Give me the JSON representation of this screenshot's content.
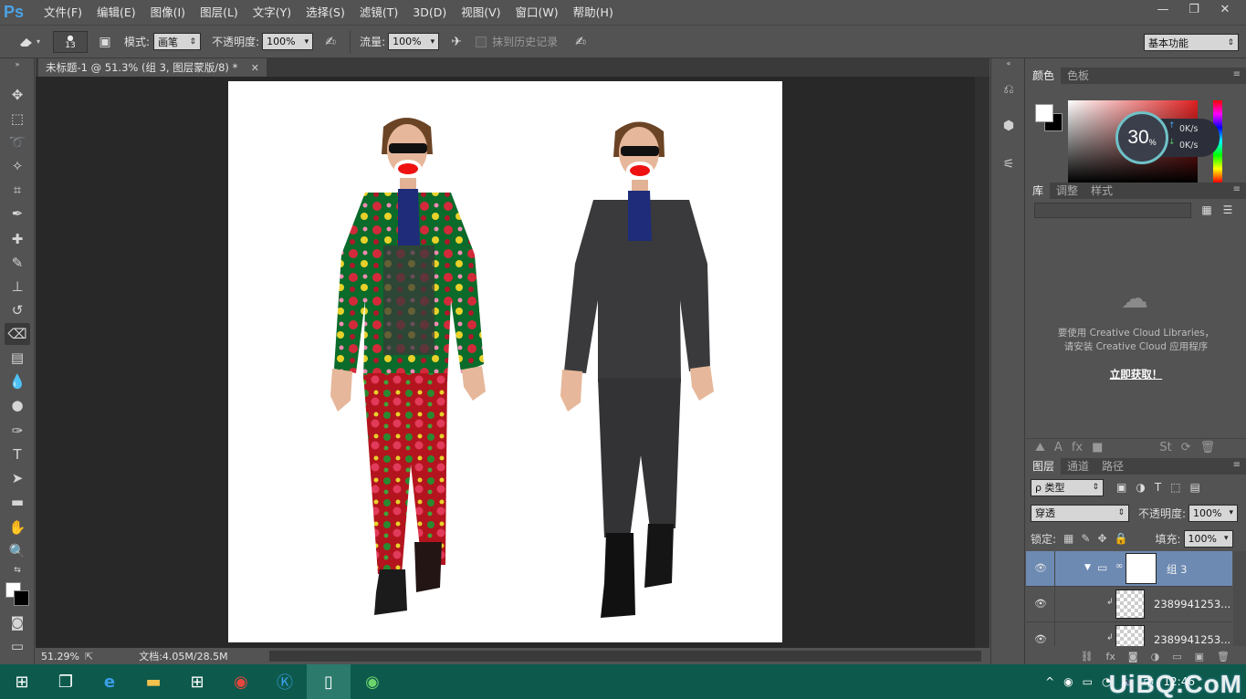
{
  "app": {
    "logo": "Ps"
  },
  "menu": [
    "文件(F)",
    "编辑(E)",
    "图像(I)",
    "图层(L)",
    "文字(Y)",
    "选择(S)",
    "滤镜(T)",
    "3D(D)",
    "视图(V)",
    "窗口(W)",
    "帮助(H)"
  ],
  "window_controls": {
    "minimize": "—",
    "restore": "❐",
    "close": "✕"
  },
  "options": {
    "brush_size": "13",
    "mode_label": "模式:",
    "mode_value": "画笔",
    "opacity_label": "不透明度:",
    "opacity_value": "100%",
    "flow_label": "流量:",
    "flow_value": "100%",
    "history_label": "抹到历史记录",
    "workspace": "基本功能"
  },
  "document": {
    "tab_title": "未标题-1 @ 51.3% (组 3, 图层蒙版/8) *",
    "zoom": "51.29%",
    "doc_info": "文档:4.05M/28.5M"
  },
  "color_panel": {
    "tabs": [
      "颜色",
      "色板"
    ],
    "foreground": "#ffffff",
    "background": "#000000"
  },
  "net_widget": {
    "percent": "30",
    "percent_unit": "%",
    "upload": "0K/s",
    "download": "0K/s"
  },
  "library_panel": {
    "tabs": [
      "库",
      "调整",
      "样式"
    ],
    "message_line1": "要使用 Creative Cloud Libraries，",
    "message_line2": "请安装 Creative Cloud 应用程序",
    "link": "立即获取！"
  },
  "layers_panel": {
    "tabs": [
      "图层",
      "通道",
      "路径"
    ],
    "filter": "ρ 类型",
    "blend_mode": "穿透",
    "opacity_label": "不透明度:",
    "opacity_value": "100%",
    "lock_label": "锁定:",
    "fill_label": "填充:",
    "fill_value": "100%",
    "layers": [
      {
        "name": "组 3"
      },
      {
        "name": "2389941253..."
      },
      {
        "name": "2389941253..."
      }
    ]
  },
  "taskbar": {
    "time": "12:46",
    "watermark": "UiBQ.CoM"
  },
  "colors": {
    "accent_selected_layer": "#6d8ab3",
    "taskbar": "#0d5a4d",
    "ps_blue": "#4aa3e6"
  },
  "icons": {
    "eye": "👁",
    "folder": "📁",
    "chain": "⛓"
  }
}
